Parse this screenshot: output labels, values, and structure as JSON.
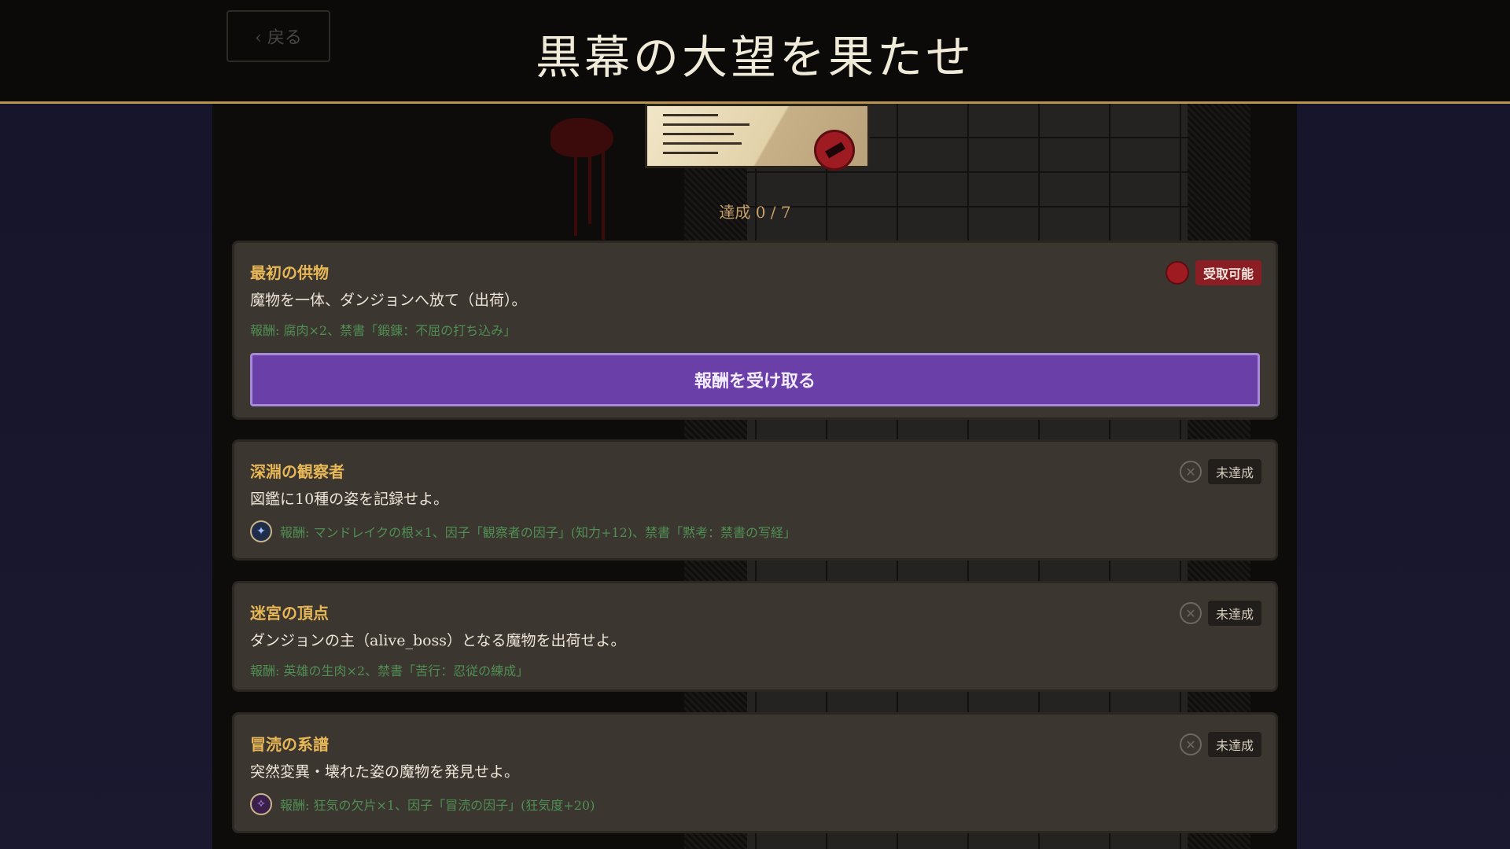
{
  "header": {
    "back_label": "‹ 戻る",
    "title": "黒幕の大望を果たせ"
  },
  "progress": {
    "text": "達成 0 / 7"
  },
  "quests": [
    {
      "title": "最初の供物",
      "description": "魔物を一体、ダンジョンへ放て（出荷）。",
      "reward": "報酬: 腐肉×2、禁書「鍛錬：不屈の打ち込み」",
      "status": "受取可能",
      "action_label": "報酬を受け取る"
    },
    {
      "title": "深淵の観察者",
      "description": "図鑑に10種の姿を記録せよ。",
      "reward": "報酬: マンドレイクの根×1、因子「観察者の因子」(知力+12)、禁書「黙考：禁書の写経」",
      "reward_icon": "eye-orb-icon",
      "status": "未達成"
    },
    {
      "title": "迷宮の頂点",
      "description": "ダンジョンの主（alive_boss）となる魔物を出荷せよ。",
      "reward": "報酬: 英雄の生肉×2、禁書「苦行：忍従の練成」",
      "status": "未達成"
    },
    {
      "title": "冒涜の系譜",
      "description": "突然変異・壊れた姿の魔物を発見せよ。",
      "reward": "報酬: 狂気の欠片×1、因子「冒涜の因子」(狂気度+20)",
      "reward_icon": "madness-orb-icon",
      "status": "未達成"
    }
  ],
  "colors": {
    "accent_gold": "#b8944e",
    "title_gold": "#e8b756",
    "reward_green": "#4f8f52",
    "claim_purple": "#6b3fa8",
    "available_red": "#8b1e24"
  }
}
